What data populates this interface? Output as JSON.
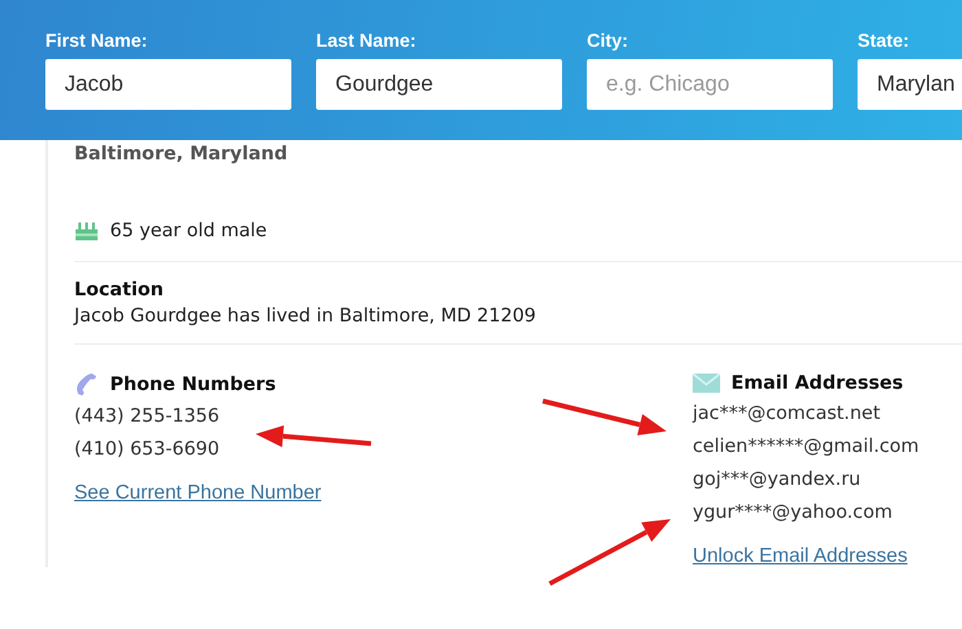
{
  "search_fields": [
    {
      "label": "First Name:",
      "value": "Jacob"
    },
    {
      "label": "Last Name:",
      "value": "Gourdgee"
    },
    {
      "label": "City:",
      "placeholder": "e.g. Chicago"
    },
    {
      "label": "State:",
      "value": "Marylan"
    }
  ],
  "profile": {
    "residence": "Baltimore, Maryland",
    "age": "65 year old male",
    "location": {
      "heading": "Location",
      "text": "Jacob Gourdgee has lived in Baltimore, MD 21209"
    },
    "phones": {
      "heading": "Phone Numbers",
      "items": [
        "(443) 255-1356",
        "(410) 653-6690"
      ],
      "link": "See Current Phone Number"
    },
    "emails": {
      "heading": "Email Addresses",
      "items": [
        "jac***@comcast.net",
        "celien******@gmail.com",
        "goj***@yandex.ru",
        "ygur****@yahoo.com"
      ],
      "link": "Unlock Email Addresses"
    }
  }
}
